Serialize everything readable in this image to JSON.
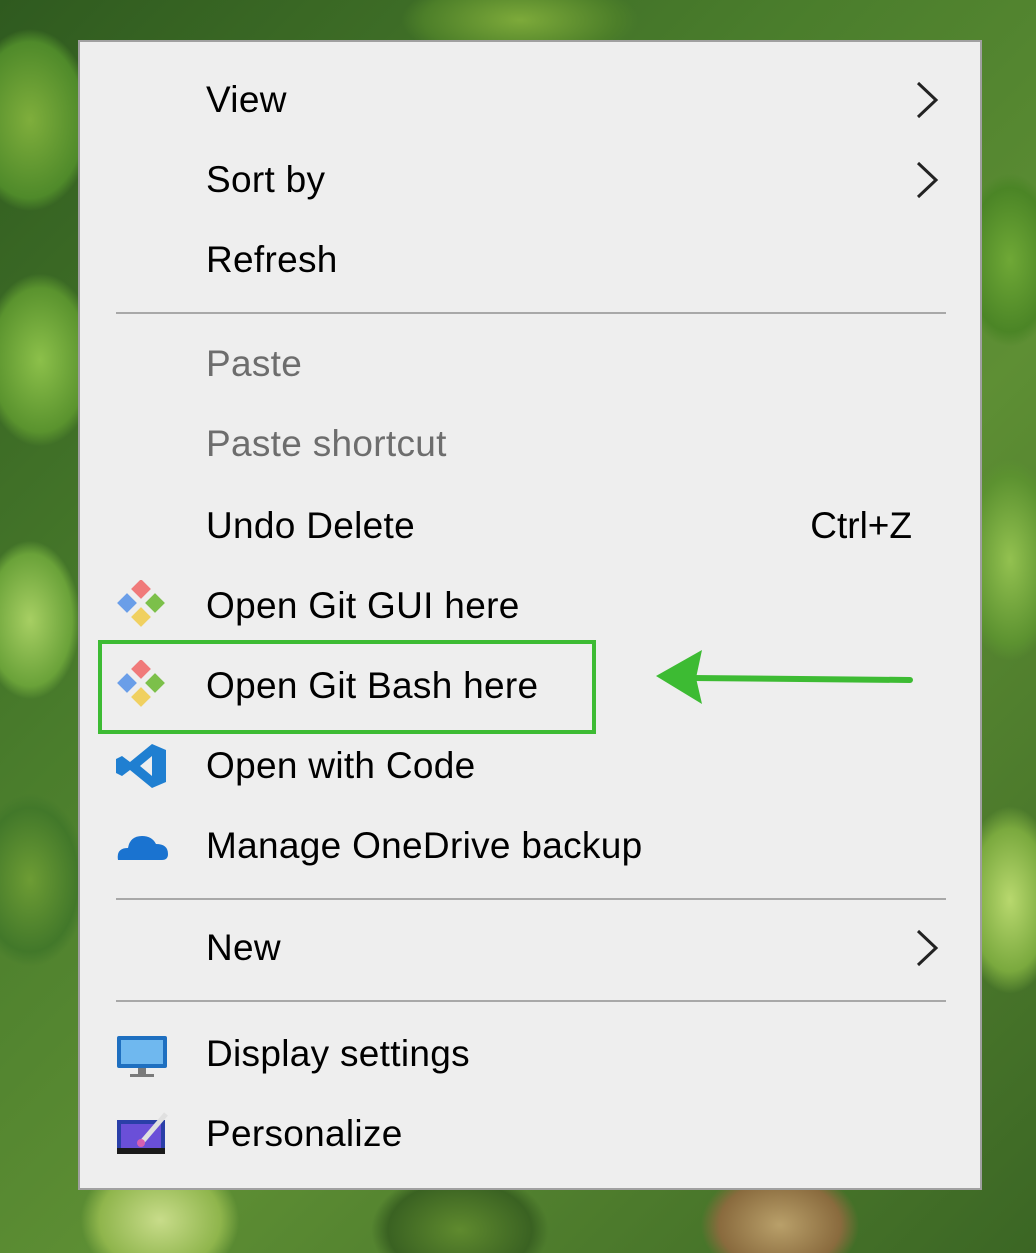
{
  "menu": {
    "items": [
      {
        "label": "View",
        "submenu": true,
        "enabled": true,
        "icon": null
      },
      {
        "label": "Sort by",
        "submenu": true,
        "enabled": true,
        "icon": null
      },
      {
        "label": "Refresh",
        "submenu": false,
        "enabled": true,
        "icon": null
      },
      {
        "label": "Paste",
        "submenu": false,
        "enabled": false,
        "icon": null
      },
      {
        "label": "Paste shortcut",
        "submenu": false,
        "enabled": false,
        "icon": null
      },
      {
        "label": "Undo Delete",
        "shortcut": "Ctrl+Z",
        "submenu": false,
        "enabled": true,
        "icon": null
      },
      {
        "label": "Open Git GUI here",
        "submenu": false,
        "enabled": true,
        "icon": "git-icon"
      },
      {
        "label": "Open Git Bash here",
        "submenu": false,
        "enabled": true,
        "icon": "git-icon",
        "annotated": true
      },
      {
        "label": "Open with Code",
        "submenu": false,
        "enabled": true,
        "icon": "vscode-icon",
        "hovered": true
      },
      {
        "label": "Manage OneDrive backup",
        "submenu": false,
        "enabled": true,
        "icon": "onedrive-icon"
      },
      {
        "label": "New",
        "submenu": true,
        "enabled": true,
        "icon": null
      },
      {
        "label": "Display settings",
        "submenu": false,
        "enabled": true,
        "icon": "display-icon"
      },
      {
        "label": "Personalize",
        "submenu": false,
        "enabled": true,
        "icon": "personalize-icon"
      }
    ]
  },
  "colors": {
    "menu_bg": "#eeeeee",
    "hover_bg": "#ffffff",
    "annotation_green": "#3dbb33",
    "disabled_text": "#6d6d6d"
  }
}
